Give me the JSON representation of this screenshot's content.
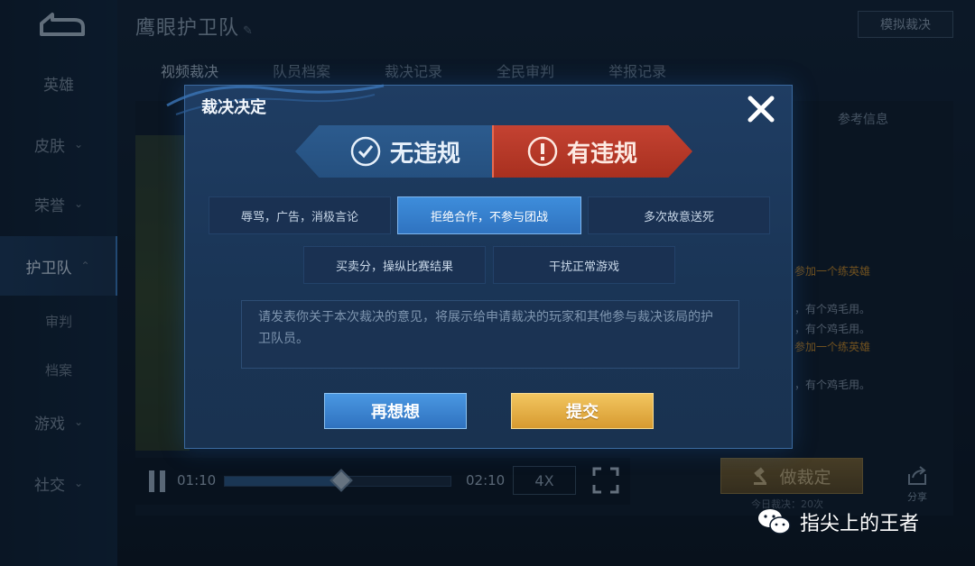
{
  "header": {
    "title": "鹰眼护卫队",
    "simulate_button": "模拟裁决"
  },
  "sidebar": {
    "items": [
      {
        "label": "英雄",
        "chevron": ""
      },
      {
        "label": "皮肤",
        "chevron": "⌄"
      },
      {
        "label": "荣誉",
        "chevron": "⌄"
      },
      {
        "label": "护卫队",
        "chevron": "⌃"
      },
      {
        "label": "审判",
        "chevron": ""
      },
      {
        "label": "档案",
        "chevron": ""
      },
      {
        "label": "游戏",
        "chevron": "⌄"
      },
      {
        "label": "社交",
        "chevron": "⌄"
      }
    ]
  },
  "tabs": [
    "视频裁决",
    "队员档案",
    "裁决记录",
    "全民审判",
    "举报记录"
  ],
  "right_panel": {
    "title": "参考信息",
    "lines": [
      "参加一个练英雄",
      "，有个鸡毛用。",
      "，有个鸡毛用。",
      "参加一个练英雄",
      "，有个鸡毛用。"
    ]
  },
  "player": {
    "current_time": "01:10",
    "total_time": "02:10",
    "speed": "4X",
    "progress": 0.5
  },
  "actions": {
    "judge_button": "做裁定",
    "today_count": "今日裁决：20次",
    "share_label": "分享"
  },
  "modal": {
    "title": "裁决决定",
    "verdict_no": "无违规",
    "verdict_yes": "有违规",
    "reasons": [
      "辱骂，广告，消极言论",
      "拒绝合作，不参与团战",
      "多次故意送死",
      "买卖分，操纵比赛结果",
      "干扰正常游戏"
    ],
    "selected_reason_index": 1,
    "comment_placeholder": "请发表你关于本次裁决的意见，将展示给申请裁决的玩家和其他参与裁决该局的护卫队员。",
    "rethink_button": "再想想",
    "submit_button": "提交"
  },
  "watermark": {
    "text": "指尖上的王者"
  },
  "colors": {
    "accent_blue": "#3e8ddb",
    "violation_red": "#c44232",
    "gold": "#e5b048"
  }
}
